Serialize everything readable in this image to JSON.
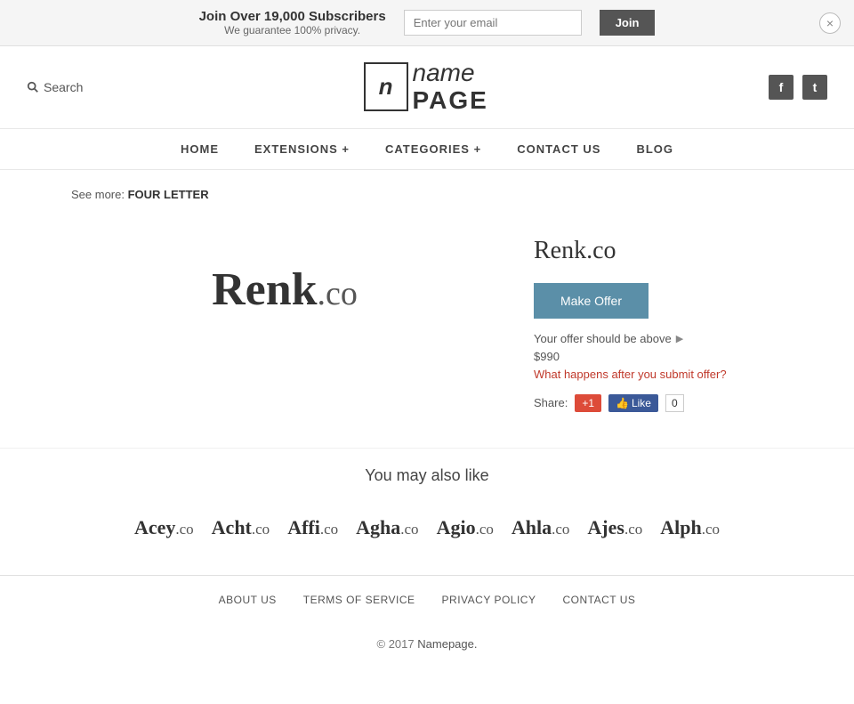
{
  "banner": {
    "main_text": "Join Over 19,000 Subscribers",
    "sub_text": "We guarantee 100% privacy.",
    "email_placeholder": "Enter your email",
    "join_label": "Join",
    "close_label": "×"
  },
  "header": {
    "search_label": "Search",
    "logo_icon": "n",
    "logo_name": "name",
    "logo_page": "PAGE",
    "facebook_icon": "f",
    "twitter_icon": "t"
  },
  "nav": {
    "items": [
      {
        "label": "HOME",
        "id": "home"
      },
      {
        "label": "EXTENSIONS +",
        "id": "extensions"
      },
      {
        "label": "CATEGORIES +",
        "id": "categories"
      },
      {
        "label": "CONTACT  US",
        "id": "contact"
      },
      {
        "label": "BLOG",
        "id": "blog"
      }
    ]
  },
  "breadcrumb": {
    "see_more_text": "See more:",
    "link_text": "FOUR LETTER"
  },
  "domain": {
    "name": "Renk",
    "tld": ".co",
    "full": "Renk.co",
    "make_offer_label": "Make Offer",
    "offer_info": "Your offer should be above",
    "offer_price": "$990",
    "what_happens": "What happens after you submit offer?",
    "share_label": "Share:",
    "gplus_label": "+1",
    "fb_like_label": "Like",
    "fb_count": "0"
  },
  "similar": {
    "heading": "You may also like",
    "items": [
      {
        "name": "Acey",
        "tld": ".co"
      },
      {
        "name": "Acht",
        "tld": ".co"
      },
      {
        "name": "Affi",
        "tld": ".co"
      },
      {
        "name": "Agha",
        "tld": ".co"
      },
      {
        "name": "Agio",
        "tld": ".co"
      },
      {
        "name": "Ahla",
        "tld": ".co"
      },
      {
        "name": "Ajes",
        "tld": ".co"
      },
      {
        "name": "Alph",
        "tld": ".co"
      }
    ]
  },
  "footer": {
    "links": [
      {
        "label": "ABOUT  US",
        "id": "about"
      },
      {
        "label": "TERMS  OF  SERVICE",
        "id": "terms"
      },
      {
        "label": "PRIVACY  POLICY",
        "id": "privacy"
      },
      {
        "label": "CONTACT  US",
        "id": "contact"
      }
    ],
    "copyright": "© 2017",
    "copyright_link": "Namepage.",
    "copyright_suffix": ""
  }
}
